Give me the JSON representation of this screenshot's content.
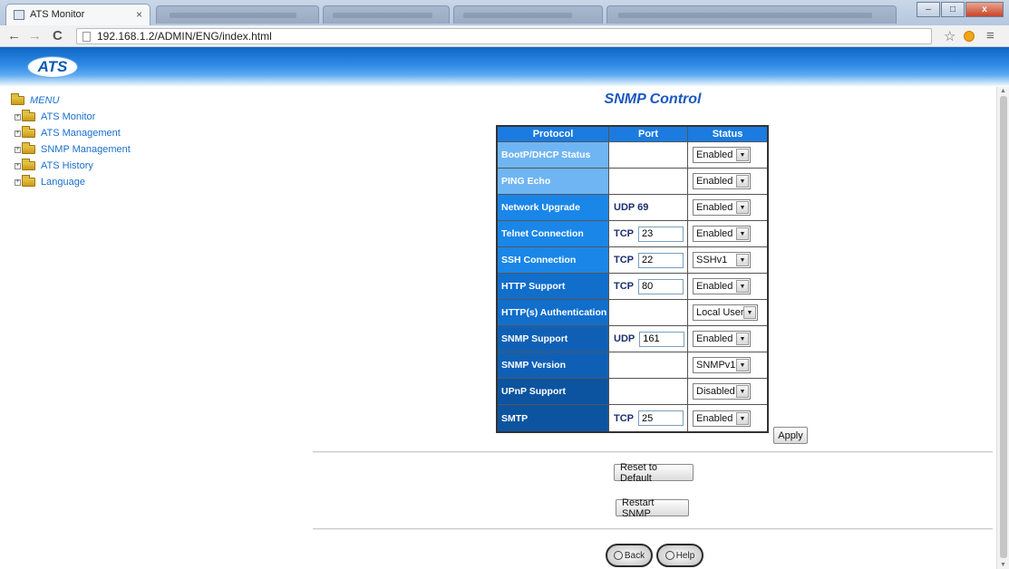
{
  "browser": {
    "tab_title": "ATS Monitor",
    "tab_close": "×",
    "url": "192.168.1.2/ADMIN/ENG/index.html",
    "back_glyph": "←",
    "forward_glyph": "→",
    "reload_glyph": "C",
    "star_glyph": "☆",
    "menu_glyph": "≡",
    "window_buttons": [
      "–",
      "□",
      "x"
    ]
  },
  "header": {
    "logo": "ATS"
  },
  "sidebar": {
    "menu_label": "MENU",
    "items": [
      {
        "label": "ATS Monitor"
      },
      {
        "label": "ATS Management"
      },
      {
        "label": "SNMP Management"
      },
      {
        "label": "ATS History"
      },
      {
        "label": "Language"
      }
    ]
  },
  "main": {
    "title": "SNMP Control",
    "table": {
      "headers": [
        "Protocol",
        "Port",
        "Status"
      ],
      "rows": [
        {
          "protocol": "BootP/DHCP Status",
          "transport": "",
          "port": "",
          "status": "Enabled",
          "color": "#6fb5f3"
        },
        {
          "protocol": "PING Echo",
          "transport": "",
          "port": "",
          "status": "Enabled",
          "color": "#6fb5f3"
        },
        {
          "protocol": "Network Upgrade",
          "transport": "UDP 69",
          "port": "",
          "status": "Enabled",
          "color": "#1a86e8"
        },
        {
          "protocol": "Telnet Connection",
          "transport": "TCP",
          "port": "23",
          "status": "Enabled",
          "color": "#1a86e8"
        },
        {
          "protocol": "SSH Connection",
          "transport": "TCP",
          "port": "22",
          "status": "SSHv1",
          "color": "#1a86e8"
        },
        {
          "protocol": "HTTP Support",
          "transport": "TCP",
          "port": "80",
          "status": "Enabled",
          "color": "#126ecb"
        },
        {
          "protocol": "HTTP(s) Authentication",
          "transport": "",
          "port": "",
          "status": "Local User",
          "color": "#126ecb"
        },
        {
          "protocol": "SNMP Support",
          "transport": "UDP",
          "port": "161",
          "status": "Enabled",
          "color": "#0f60b5"
        },
        {
          "protocol": "SNMP Version",
          "transport": "",
          "port": "",
          "status": "SNMPv1",
          "color": "#0f60b5"
        },
        {
          "protocol": "UPnP Support",
          "transport": "",
          "port": "",
          "status": "Disabled",
          "color": "#0c54a0"
        },
        {
          "protocol": "SMTP",
          "transport": "TCP",
          "port": "25",
          "status": "Enabled",
          "color": "#0c54a0"
        }
      ]
    },
    "apply_label": "Apply",
    "reset_label": "Reset to Default",
    "restart_label": "Restart SNMP",
    "back_label": "Back",
    "help_label": "Help"
  }
}
